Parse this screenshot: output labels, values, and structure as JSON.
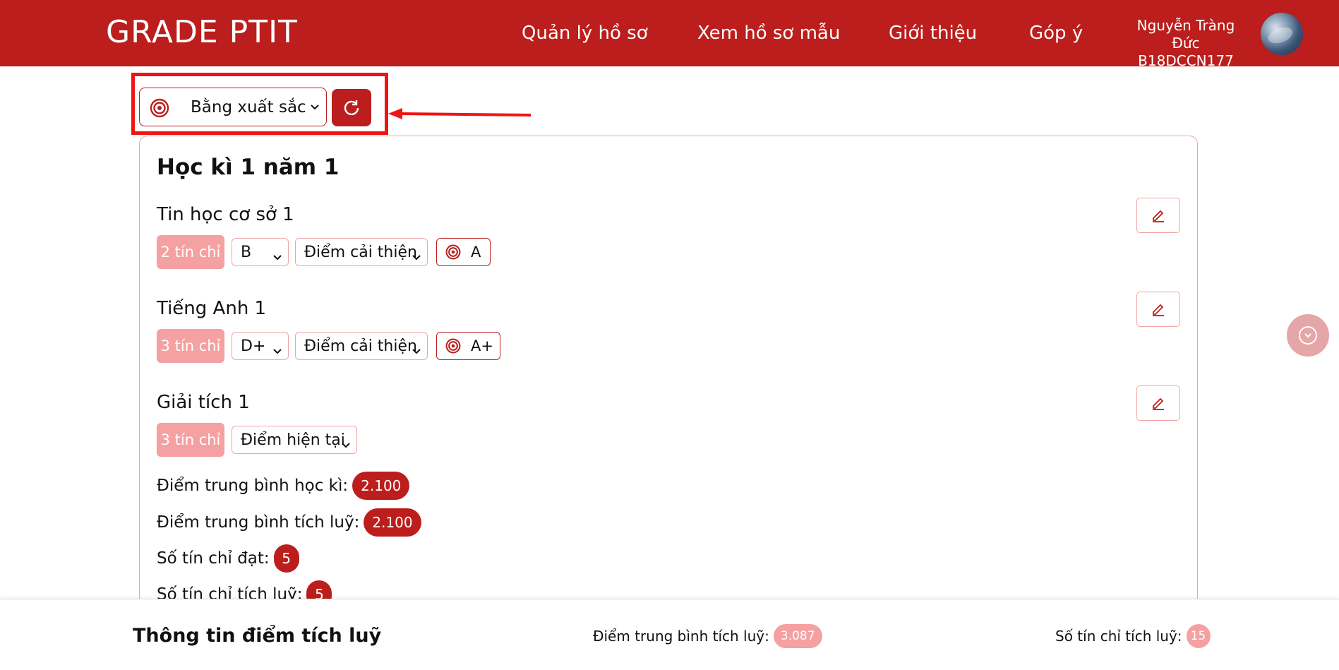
{
  "header": {
    "brand": "GRADE PTIT",
    "nav": [
      {
        "label": "Quản lý hồ sơ"
      },
      {
        "label": "Xem hồ sơ mẫu"
      },
      {
        "label": "Giới thiệu"
      },
      {
        "label": "Góp ý"
      }
    ],
    "user": {
      "name": "Nguyễn Tràng Đức",
      "id": "B18DCCN177"
    }
  },
  "goal": {
    "selected": "Bằng xuất sắc",
    "icon": "target-icon",
    "refresh_icon": "refresh-icon"
  },
  "semester": {
    "title": "Học kì 1 năm 1",
    "subjects": [
      {
        "name": "Tin học cơ sở 1",
        "credits": "2 tín chỉ",
        "grade": "B",
        "mode": "Điểm cải thiện",
        "target": "A"
      },
      {
        "name": "Tiếng Anh 1",
        "credits": "3 tín chỉ",
        "grade": "D+",
        "mode": "Điểm cải thiện",
        "target": "A+"
      },
      {
        "name": "Giải tích 1",
        "credits": "3 tín chỉ",
        "mode": "Điểm hiện tại"
      }
    ],
    "stats": {
      "gpa_label": "Điểm trung bình học kì:",
      "gpa_value": "2.100",
      "cum_label": "Điểm trung bình tích luỹ:",
      "cum_value": "2.100",
      "credits_passed_label": "Số tín chỉ đạt:",
      "credits_passed_value": "5",
      "credits_cum_label": "Số tín chỉ tích luỹ:",
      "credits_cum_value": "5"
    }
  },
  "footer": {
    "title": "Thông tin điểm tích luỹ",
    "gpa_label": "Điểm trung bình tích luỹ:",
    "gpa_value": "3.087",
    "credits_label": "Số tín chỉ tích luỹ:",
    "credits_value": "15"
  },
  "colors": {
    "primary": "#bb1e1c",
    "light": "#f5a0a1",
    "annotation": "#f01414"
  }
}
